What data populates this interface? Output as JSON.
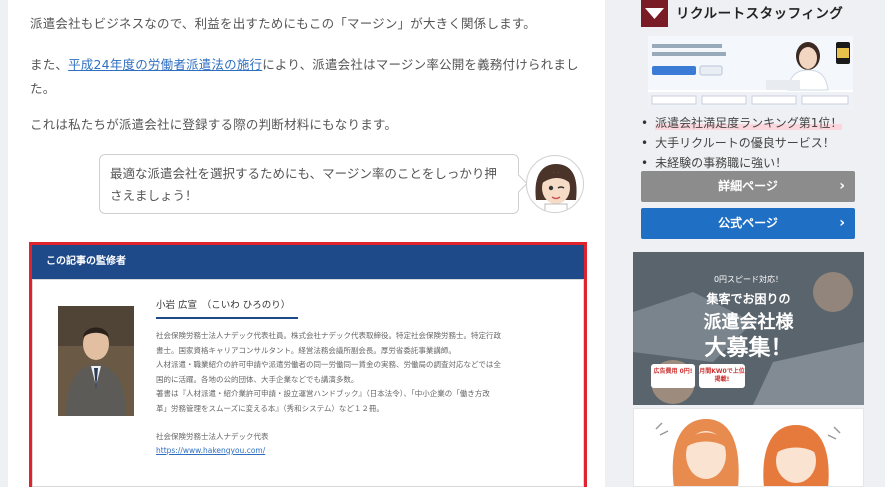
{
  "article": {
    "para1": "派遣会社もビジネスなので、利益を出すためにもこの「マージン」が大きく関係します。",
    "para2_before": "また、",
    "para2_link": "平成24年度の労働者派遣法の施行",
    "para2_line1_after": "により、派遣会社はマージン率公開を義務付けられまし",
    "para2_line2": "た。",
    "para3": "これは私たちが派遣会社に登録する際の判断材料にもなります。",
    "bubble_line1": "最適な派遣会社を選択するためにも、マージン率のことをしっかり押",
    "bubble_line2": "さえましょう！"
  },
  "supervisor": {
    "heading": "この記事の監修者",
    "name": "小岩 広宣　（こいわ ひろのり）",
    "bio": [
      "社会保険労務士法人ナデック代表社員。株式会社ナデック代表取締役。特定社会保険労務士。特定行政",
      "書士。国家資格キャリアコンサルタント。経営法務会議所副会長。厚労省委託事業講師。",
      "人材派遣・職業紹介の許可申請や派遣労働者の同一労働同一賃金の実務、労働局の調査対応などでは全",
      "国的に活躍。各地の公的団体、大手企業などでも講演多数。",
      "著書は『人材派遣・紹介業許可申請・設立運営ハンドブック』（日本法令）、「中小企業の「働き方改",
      "革」労務管理をスムーズに変える本』（秀和システム）など１２冊。"
    ],
    "org": "社会保険労務士法人ナデック代表",
    "url": "https://www.hakengyou.com/"
  },
  "sidebar": {
    "brand": "リクルートスタッフィング",
    "features": [
      "派遣会社満足度ランキング第1位！",
      "大手リクルートの優良サービス！",
      "未経験の事務職に強い！"
    ],
    "detail_button": "詳細ページ",
    "official_button": "公式ページ",
    "banner2": {
      "badge": "0円スピード対応！",
      "line1": "集客でお困りの",
      "line2": "派遣会社様",
      "line3": "大募集！",
      "tag1": "広告費用 0円!",
      "tag2": "月間KW0で上位掲載!"
    }
  },
  "colors": {
    "header_blue": "#1e4a8a",
    "frame_red": "#e0242d",
    "button_blue": "#1f6fc4",
    "button_gray": "#8c8c8c",
    "link": "#2f6fc0"
  }
}
